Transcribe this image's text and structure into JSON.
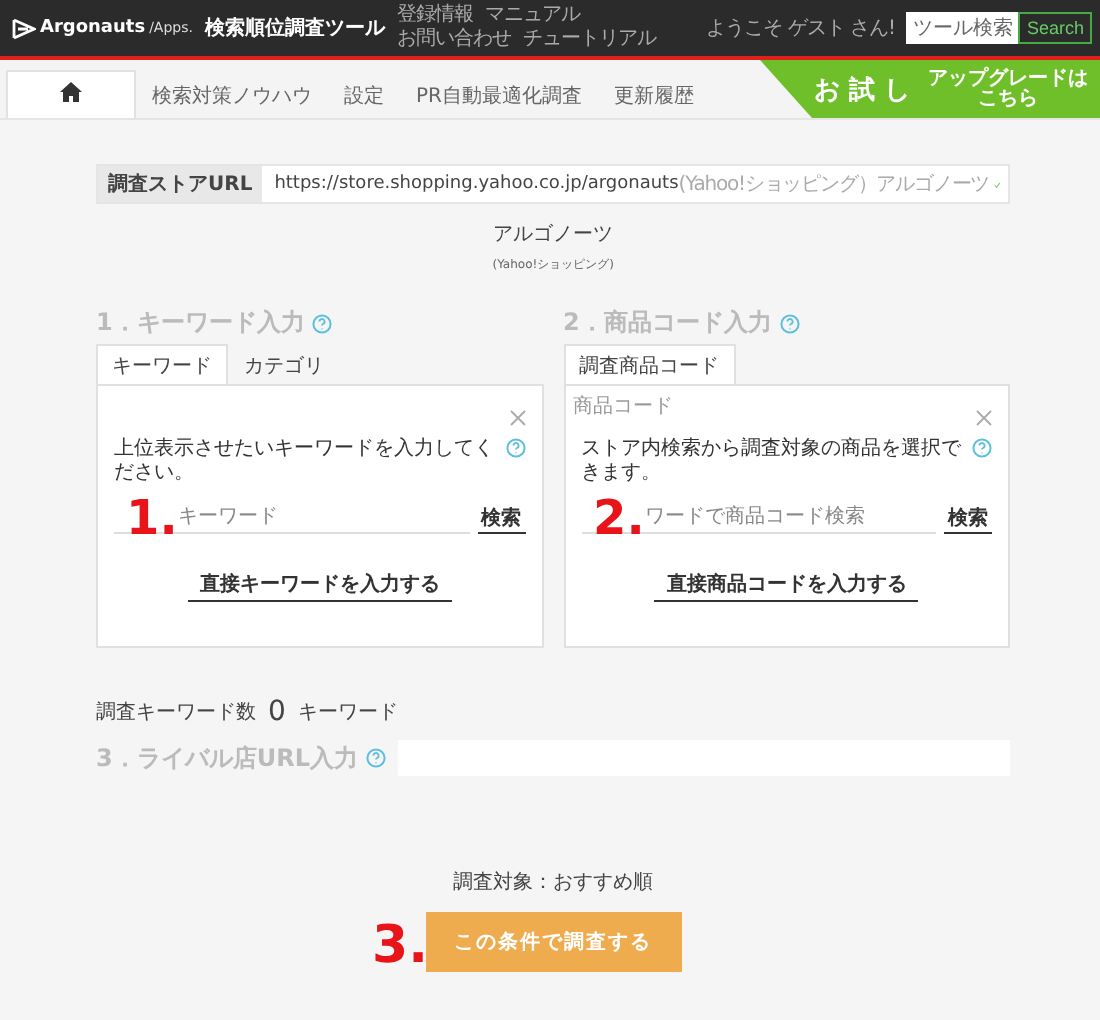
{
  "header": {
    "logo": "Argonauts",
    "logo_suffix": "/Apps.",
    "title": "検索順位調査ツール",
    "nav": [
      "登録情報",
      "マニュアル",
      "お問い合わせ",
      "チュートリアル"
    ],
    "welcome": "ようこそ ゲスト さん!",
    "search": {
      "placeholder": "ツール検索",
      "button": "Search"
    }
  },
  "tabs": [
    {
      "kind": "home",
      "selected": true
    },
    {
      "kind": "text",
      "label": "検索対策ノウハウ",
      "selected": false
    },
    {
      "kind": "text",
      "label": "設定",
      "selected": false
    },
    {
      "kind": "text",
      "label": "PR自動最適化調査",
      "selected": false
    },
    {
      "kind": "text",
      "label": "更新履歴",
      "selected": false
    }
  ],
  "trial": {
    "label": "お 試 し",
    "upgrade": "アップグレードはこちら"
  },
  "store": {
    "label": "調査ストアURL",
    "url": "https://store.shopping.yahoo.co.jp/argonauts",
    "store_name": "(Yahoo!ショッピング）アルゴノーツ",
    "verified": true
  },
  "store_title": "アルゴノーツ",
  "store_subtitle": "(Yahoo!ショッピング)",
  "sections": [
    {
      "heading": "1．キーワード入力",
      "tabs": [
        {
          "label": "キーワード",
          "selected": true
        },
        {
          "label": "カテゴリ",
          "selected": false
        }
      ],
      "prompt": "上位表示させたいキーワードを入力してください。",
      "field": {
        "placeholder": "キーワード"
      },
      "search_button": "検索",
      "direct_button": "直接キーワードを入力する",
      "annotation": "1."
    },
    {
      "heading": "2．商品コード入力",
      "tabs": [
        {
          "label": "調査商品コード",
          "selected": true
        }
      ],
      "caption": "商品コード",
      "prompt": "ストア内検索から調査対象の商品を選択できます。",
      "field": {
        "placeholder": "ワードで商品コード検索"
      },
      "search_button": "検索",
      "direct_button": "直接商品コードを入力する",
      "annotation": "2."
    }
  ],
  "keyword_count": {
    "label": "調査キーワード数",
    "value": "0",
    "unit": "キーワード"
  },
  "rival": {
    "heading": "3．ライバル店URL入力"
  },
  "target": "調査対象：おすすめ順",
  "submit": {
    "label": "この条件で調査する",
    "annotation": "3."
  }
}
